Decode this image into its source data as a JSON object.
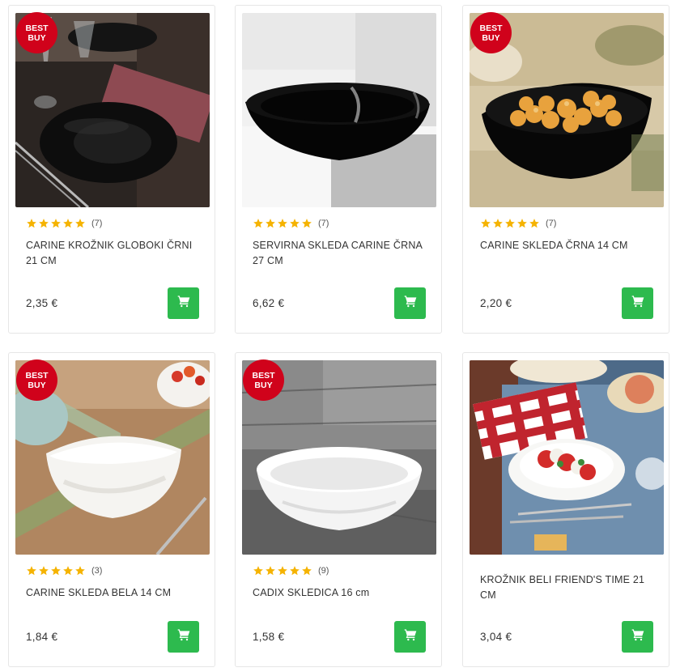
{
  "products": [
    {
      "badge": [
        "BEST",
        "BUY"
      ],
      "has_badge": true,
      "rating": 5,
      "rating_count": "(7)",
      "title": "CARINE KROŽNIK GLOBOKI ČRNI 21 CM",
      "price": "2,35 €",
      "image": "black-deep-plate-on-table"
    },
    {
      "badge": [
        "",
        ""
      ],
      "has_badge": false,
      "rating": 5,
      "rating_count": "(7)",
      "title": "SERVIRNA SKLEDA CARINE ČRNA 27 CM",
      "price": "6,62 €",
      "image": "black-serving-bowl"
    },
    {
      "badge": [
        "BEST",
        "BUY"
      ],
      "has_badge": true,
      "rating": 5,
      "rating_count": "(7)",
      "title": "CARINE SKLEDA ČRNA 14 CM",
      "price": "2,20 €",
      "image": "black-bowl-with-food"
    },
    {
      "badge": [
        "BEST",
        "BUY"
      ],
      "has_badge": true,
      "rating": 5,
      "rating_count": "(3)",
      "title": "CARINE SKLEDA BELA 14 CM",
      "price": "1,84 €",
      "image": "white-square-bowl"
    },
    {
      "badge": [
        "BEST",
        "BUY"
      ],
      "has_badge": true,
      "rating": 5,
      "rating_count": "(9)",
      "title": "CADIX SKLEDICA 16 cm",
      "price": "1,58 €",
      "image": "white-round-bowl"
    },
    {
      "badge": [
        "",
        ""
      ],
      "has_badge": false,
      "rating": null,
      "rating_count": "",
      "title": "KROŽNIK BELI FRIEND'S TIME 21 CM",
      "price": "3,04 €",
      "image": "white-plate-with-salad"
    }
  ],
  "colors": {
    "badge": "#d0021b",
    "star": "#f5b301",
    "cart_button": "#2dba4e"
  },
  "icons": {
    "cart": "shopping-cart-icon",
    "star": "star-icon"
  }
}
